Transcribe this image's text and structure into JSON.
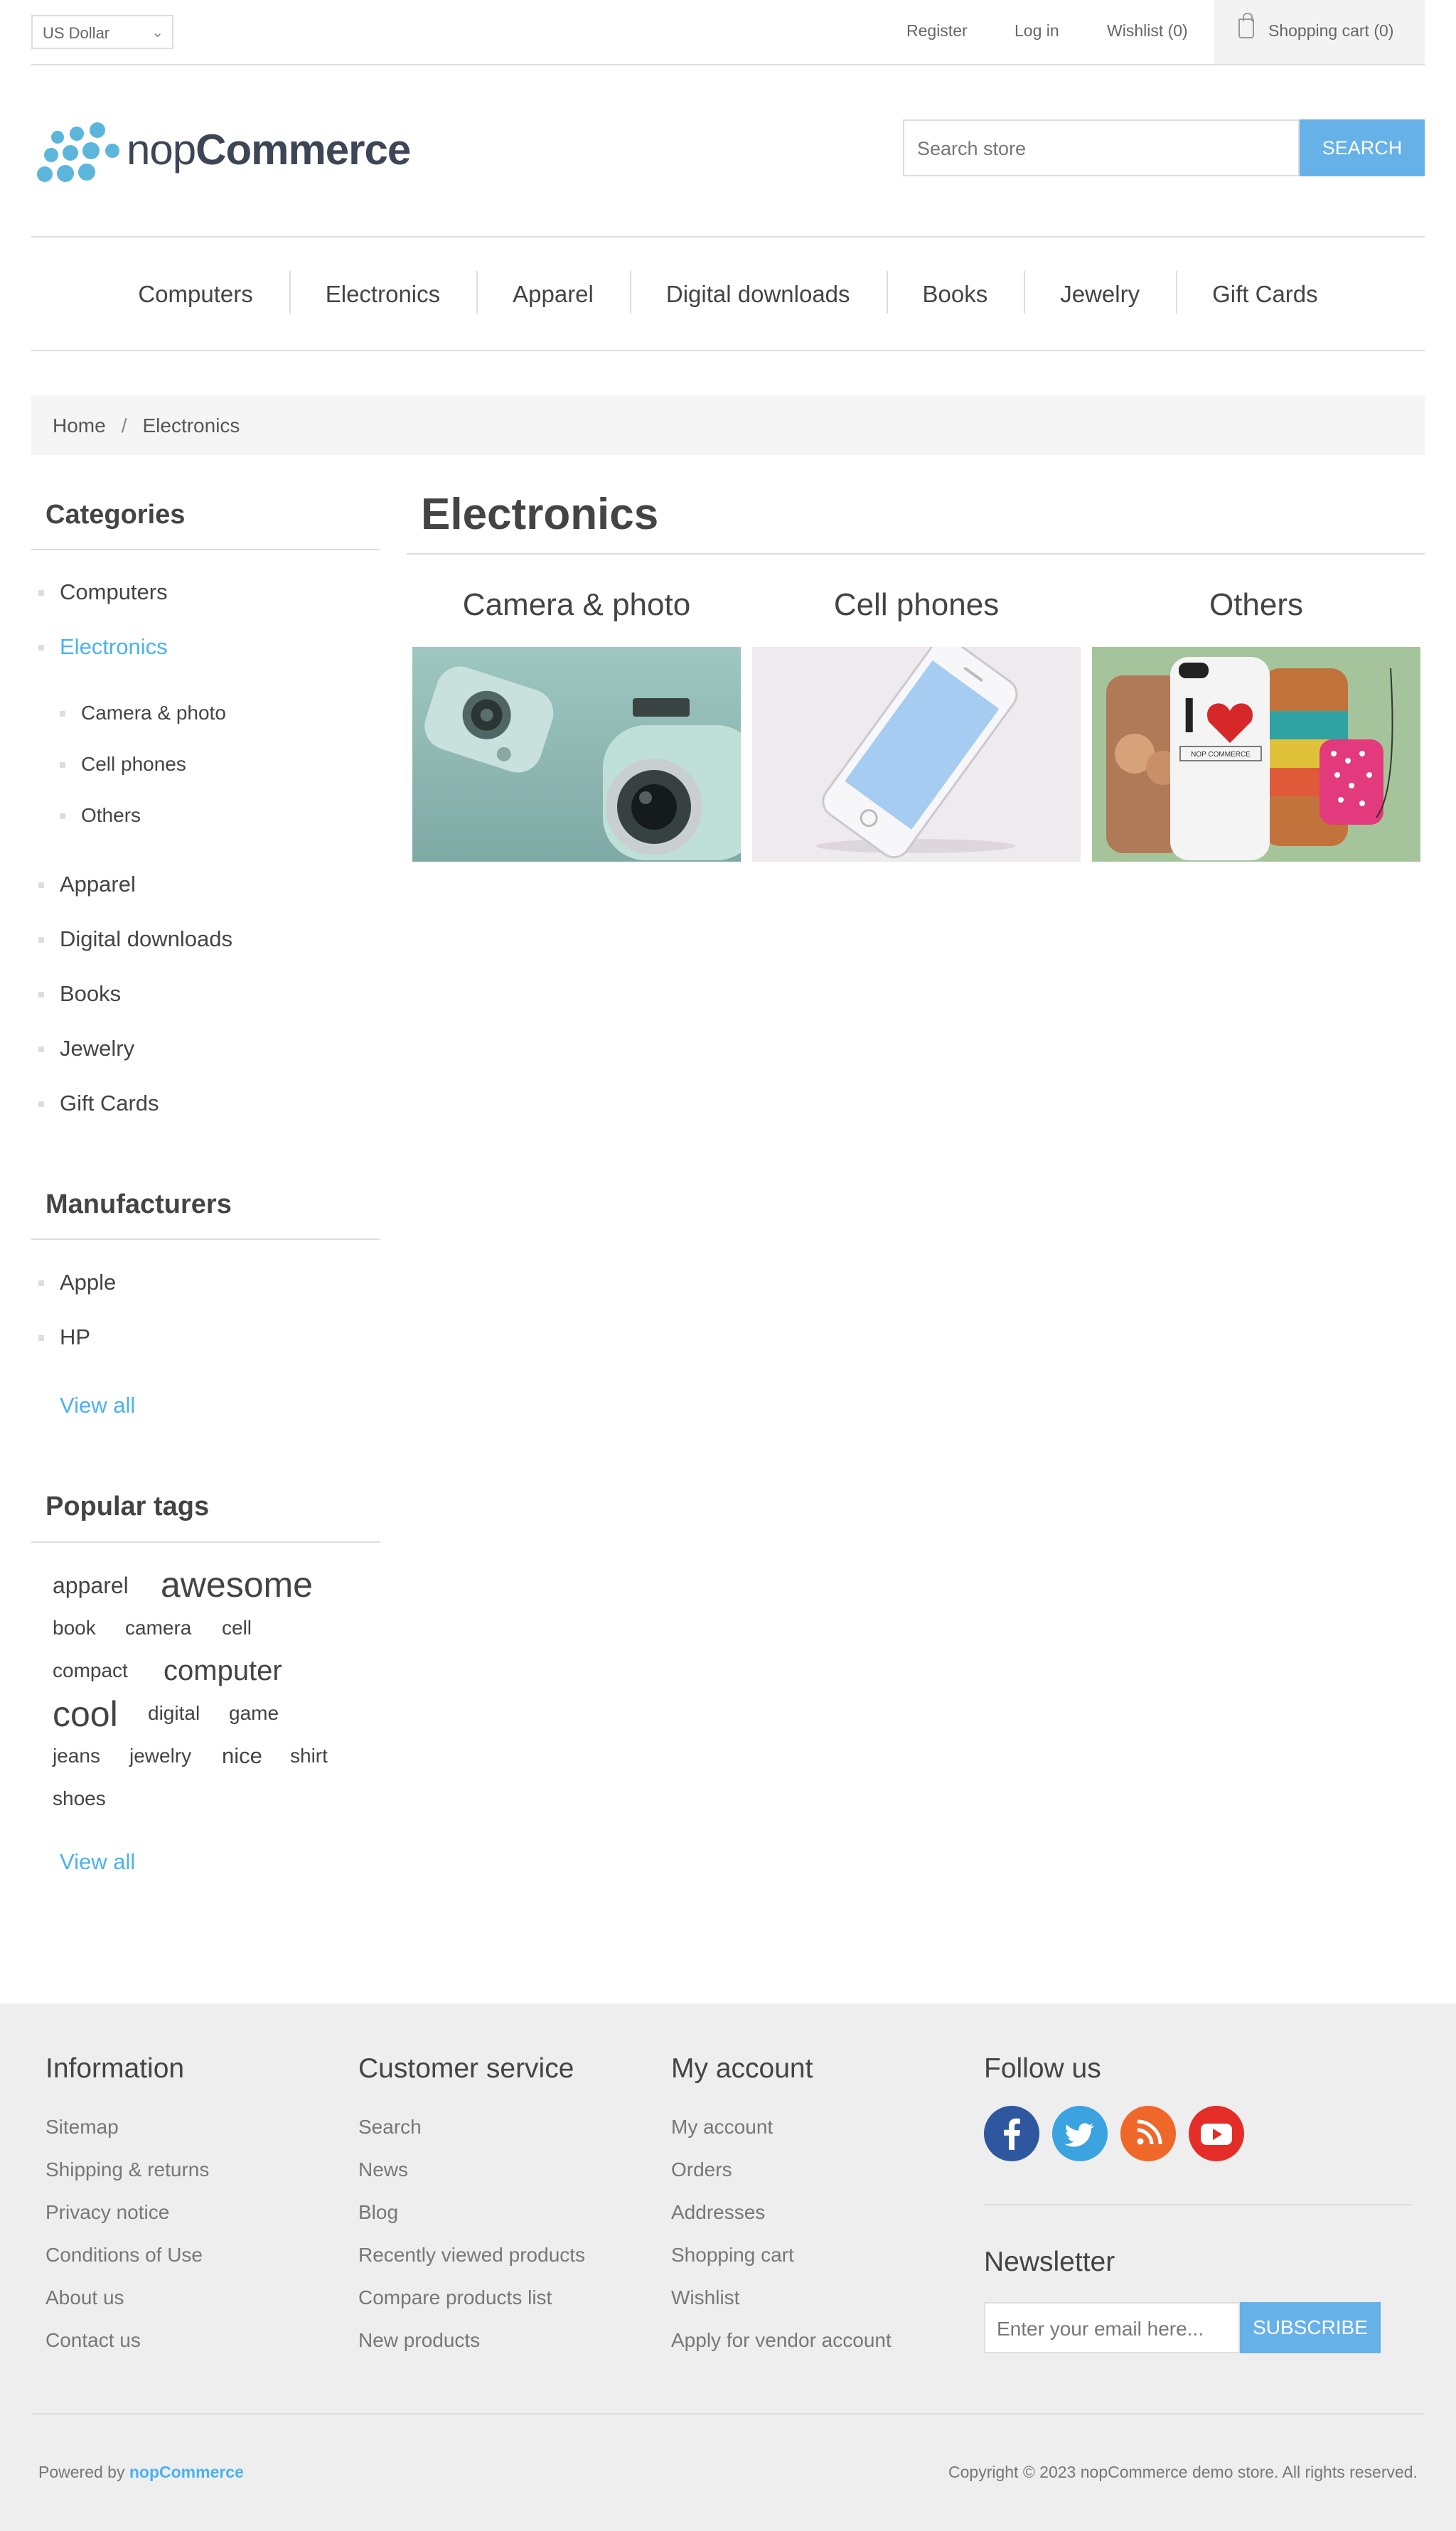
{
  "header": {
    "currency": "US Dollar",
    "links": {
      "register": "Register",
      "login": "Log in",
      "wishlist": "Wishlist (0)",
      "cart": "Shopping cart (0)"
    },
    "logo": {
      "light": "nop",
      "bold": "Commerce"
    },
    "search": {
      "placeholder": "Search store",
      "button": "SEARCH"
    }
  },
  "menu": [
    "Computers",
    "Electronics",
    "Apparel",
    "Digital downloads",
    "Books",
    "Jewelry",
    "Gift Cards"
  ],
  "breadcrumb": {
    "home": "Home",
    "separator": "/",
    "current": "Electronics"
  },
  "sidebar": {
    "categories": {
      "title": "Categories",
      "items": [
        "Computers",
        "Electronics",
        "Apparel",
        "Digital downloads",
        "Books",
        "Jewelry",
        "Gift Cards"
      ],
      "subitems": [
        "Camera & photo",
        "Cell phones",
        "Others"
      ]
    },
    "manufacturers": {
      "title": "Manufacturers",
      "items": [
        "Apple",
        "HP"
      ],
      "view_all": "View all"
    },
    "tags": {
      "title": "Popular tags",
      "items": [
        "apparel",
        "awesome",
        "book",
        "camera",
        "cell",
        "compact",
        "computer",
        "cool",
        "digital",
        "game",
        "jeans",
        "jewelry",
        "nice",
        "shirt",
        "shoes"
      ],
      "view_all": "View all"
    }
  },
  "main": {
    "title": "Electronics",
    "subcategories": [
      "Camera & photo",
      "Cell phones",
      "Others"
    ],
    "tee_print": {
      "brand": "NOP COMMERCE"
    }
  },
  "footer": {
    "information": {
      "title": "Information",
      "links": [
        "Sitemap",
        "Shipping & returns",
        "Privacy notice",
        "Conditions of Use",
        "About us",
        "Contact us"
      ]
    },
    "customer_service": {
      "title": "Customer service",
      "links": [
        "Search",
        "News",
        "Blog",
        "Recently viewed products",
        "Compare products list",
        "New products"
      ]
    },
    "my_account": {
      "title": "My account",
      "links": [
        "My account",
        "Orders",
        "Addresses",
        "Shopping cart",
        "Wishlist",
        "Apply for vendor account"
      ]
    },
    "follow": {
      "title": "Follow us",
      "icons": [
        "facebook-icon",
        "twitter-icon",
        "rss-icon",
        "youtube-icon"
      ]
    },
    "newsletter": {
      "title": "Newsletter",
      "placeholder": "Enter your email here...",
      "button": "SUBSCRIBE"
    },
    "powered_prefix": "Powered by",
    "powered_brand": "nopCommerce",
    "copyright": "Copyright © 2023 nopCommerce demo store. All rights reserved."
  },
  "colors": {
    "accent": "#4ab2f1",
    "button": "#67b1e9",
    "footer_bg": "#eeeeee"
  }
}
